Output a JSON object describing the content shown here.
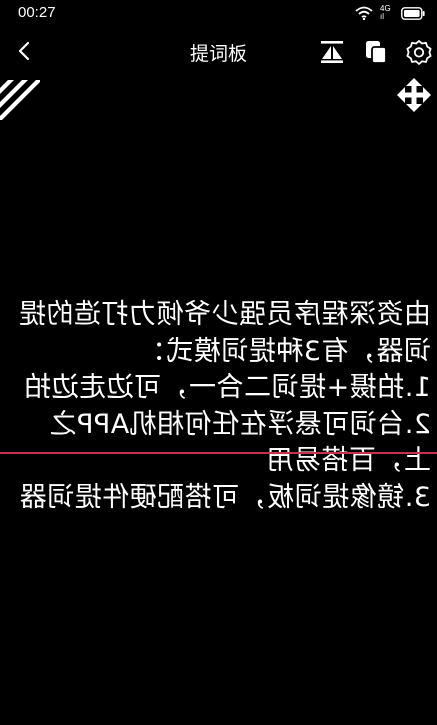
{
  "status_bar": {
    "time": "00:27",
    "network_label_top": "4G",
    "network_label_bottom": "ıl",
    "icons": [
      "wifi-icon",
      "signal-icon",
      "battery-icon"
    ]
  },
  "header": {
    "title": "提词板",
    "icons": [
      "back-icon",
      "mirror-flip-icon",
      "copy-icon",
      "settings-icon"
    ]
  },
  "overlay": {
    "icons": [
      "stripe-corner-icon",
      "move-icon"
    ]
  },
  "prompter": {
    "mirrored": true,
    "text": "由资深程序员强少爷倾力打造的提词器，有3种提词模式：\n1.拍摄+提词二合一，可边走边拍\n2.台词可悬浮在任何相机APP之上，百搭易用\n3.镜像提词板，可搭配硬件提词器"
  },
  "colors": {
    "background": "#000000",
    "text": "#ffffff",
    "read_line": "#c8324a"
  }
}
